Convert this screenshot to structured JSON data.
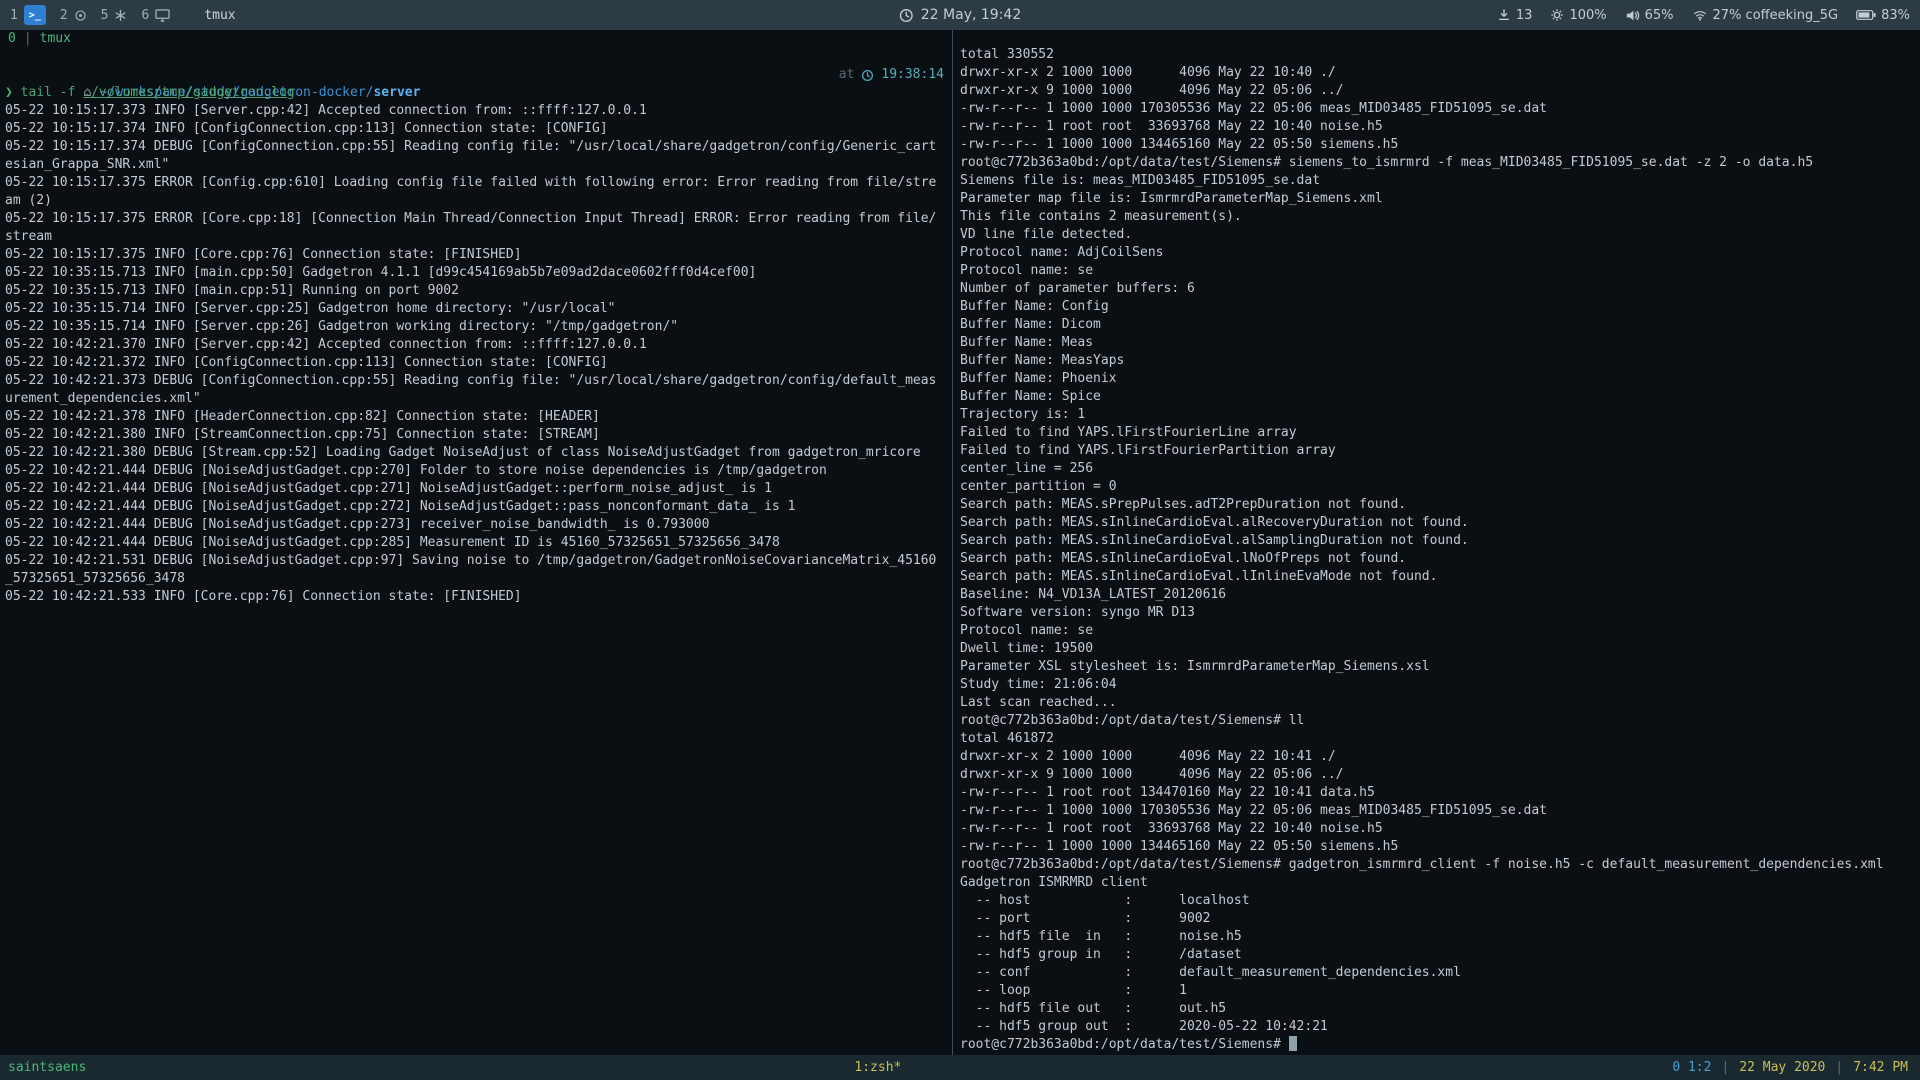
{
  "colors": {
    "terminal_bg": "#0a0f14",
    "topbar_bg": "#2d3c44",
    "statusbar_bg": "#1a2930",
    "text": "#c2cbd1",
    "green": "#4cb577",
    "yellow": "#c9bd55",
    "blue": "#4aa0d5",
    "cyan": "#58aebc",
    "accent_blue": "#2f7fd4",
    "cmd_green": "#4da273",
    "path_blue": "#3d8fd1",
    "dim": "#5a6a72"
  },
  "topbar": {
    "workspaces": [
      {
        "label": "1",
        "icon": "terminal-icon",
        "icon_glyph": ">_",
        "active": true
      },
      {
        "label": "2",
        "icon": "circle-icon",
        "active": false
      },
      {
        "label": "5",
        "icon": "asterisk-icon",
        "active": false
      },
      {
        "label": "6",
        "icon": "monitor-icon",
        "active": false
      }
    ],
    "window_title": "tmux",
    "clock": "22 May, 19:42",
    "status": {
      "downloads": "13",
      "brightness": "100%",
      "volume": "65%",
      "wifi": "27% coffeeking_5G",
      "battery": "83%"
    }
  },
  "left_pane": {
    "tmux_inner_status": {
      "window_index": "0",
      "separator": "|",
      "session_name": "tmux"
    },
    "prompt": {
      "symbol": "⌂",
      "path_prefix": "~/workspace/study/gadgetron-docker/",
      "path_current": "server",
      "at_label": "at",
      "time": "19:38:14"
    },
    "command": {
      "symbol": "❯ ",
      "text": "tail -f ",
      "arg": "./volumes/tmp/gadgetron.log"
    },
    "log_lines": [
      "05-22 10:15:17.373 INFO [Server.cpp:42] Accepted connection from: ::ffff:127.0.0.1",
      "05-22 10:15:17.374 INFO [ConfigConnection.cpp:113] Connection state: [CONFIG]",
      "05-22 10:15:17.374 DEBUG [ConfigConnection.cpp:55] Reading config file: \"/usr/local/share/gadgetron/config/Generic_cart",
      "esian_Grappa_SNR.xml\"",
      "05-22 10:15:17.375 ERROR [Config.cpp:610] Loading config file failed with following error: Error reading from file/stre",
      "am (2)",
      "05-22 10:15:17.375 ERROR [Core.cpp:18] [Connection Main Thread/Connection Input Thread] ERROR: Error reading from file/",
      "stream",
      "05-22 10:15:17.375 INFO [Core.cpp:76] Connection state: [FINISHED]",
      "05-22 10:35:15.713 INFO [main.cpp:50] Gadgetron 4.1.1 [d99c454169ab5b7e09ad2dace0602fff0d4cef00]",
      "05-22 10:35:15.713 INFO [main.cpp:51] Running on port 9002",
      "05-22 10:35:15.714 INFO [Server.cpp:25] Gadgetron home directory: \"/usr/local\"",
      "05-22 10:35:15.714 INFO [Server.cpp:26] Gadgetron working directory: \"/tmp/gadgetron/\"",
      "05-22 10:42:21.370 INFO [Server.cpp:42] Accepted connection from: ::ffff:127.0.0.1",
      "05-22 10:42:21.372 INFO [ConfigConnection.cpp:113] Connection state: [CONFIG]",
      "05-22 10:42:21.373 DEBUG [ConfigConnection.cpp:55] Reading config file: \"/usr/local/share/gadgetron/config/default_meas",
      "urement_dependencies.xml\"",
      "05-22 10:42:21.378 INFO [HeaderConnection.cpp:82] Connection state: [HEADER]",
      "05-22 10:42:21.380 INFO [StreamConnection.cpp:75] Connection state: [STREAM]",
      "05-22 10:42:21.380 DEBUG [Stream.cpp:52] Loading Gadget NoiseAdjust of class NoiseAdjustGadget from gadgetron_mricore",
      "05-22 10:42:21.444 DEBUG [NoiseAdjustGadget.cpp:270] Folder to store noise dependencies is /tmp/gadgetron",
      "05-22 10:42:21.444 DEBUG [NoiseAdjustGadget.cpp:271] NoiseAdjustGadget::perform_noise_adjust_ is 1",
      "05-22 10:42:21.444 DEBUG [NoiseAdjustGadget.cpp:272] NoiseAdjustGadget::pass_nonconformant_data_ is 1",
      "05-22 10:42:21.444 DEBUG [NoiseAdjustGadget.cpp:273] receiver_noise_bandwidth_ is 0.793000",
      "05-22 10:42:21.444 DEBUG [NoiseAdjustGadget.cpp:285] Measurement ID is 45160_57325651_57325656_3478",
      "05-22 10:42:21.531 DEBUG [NoiseAdjustGadget.cpp:97] Saving noise to /tmp/gadgetron/GadgetronNoiseCovarianceMatrix_45160",
      "_57325651_57325656_3478",
      "05-22 10:42:21.533 INFO [Core.cpp:76] Connection state: [FINISHED]"
    ]
  },
  "right_pane": {
    "lines": [
      "total 330552",
      "drwxr-xr-x 2 1000 1000      4096 May 22 10:40 ./",
      "drwxr-xr-x 9 1000 1000      4096 May 22 05:06 ../",
      "-rw-r--r-- 1 1000 1000 170305536 May 22 05:06 meas_MID03485_FID51095_se.dat",
      "-rw-r--r-- 1 root root  33693768 May 22 10:40 noise.h5",
      "-rw-r--r-- 1 1000 1000 134465160 May 22 05:50 siemens.h5",
      "root@c772b363a0bd:/opt/data/test/Siemens# siemens_to_ismrmrd -f meas_MID03485_FID51095_se.dat -z 2 -o data.h5",
      "Siemens file is: meas_MID03485_FID51095_se.dat",
      "Parameter map file is: IsmrmrdParameterMap_Siemens.xml",
      "This file contains 2 measurement(s).",
      "VD line file detected.",
      "Protocol name: AdjCoilSens",
      "Protocol name: se",
      "Number of parameter buffers: 6",
      "Buffer Name: Config",
      "Buffer Name: Dicom",
      "Buffer Name: Meas",
      "Buffer Name: MeasYaps",
      "Buffer Name: Phoenix",
      "Buffer Name: Spice",
      "Trajectory is: 1",
      "Failed to find YAPS.lFirstFourierLine array",
      "Failed to find YAPS.lFirstFourierPartition array",
      "center_line = 256",
      "center_partition = 0",
      "Search path: MEAS.sPrepPulses.adT2PrepDuration not found.",
      "Search path: MEAS.sInlineCardioEval.alRecoveryDuration not found.",
      "Search path: MEAS.sInlineCardioEval.alSamplingDuration not found.",
      "Search path: MEAS.sInlineCardioEval.lNoOfPreps not found.",
      "Search path: MEAS.sInlineCardioEval.lInlineEvaMode not found.",
      "Baseline: N4_VD13A_LATEST_20120616",
      "Software version: syngo MR D13",
      "Protocol name: se",
      "Dwell time: 19500",
      "Parameter XSL stylesheet is: IsmrmrdParameterMap_Siemens.xsl",
      "Study time: 21:06:04",
      "Last scan reached...",
      "root@c772b363a0bd:/opt/data/test/Siemens# ll",
      "total 461872",
      "drwxr-xr-x 2 1000 1000      4096 May 22 10:41 ./",
      "drwxr-xr-x 9 1000 1000      4096 May 22 05:06 ../",
      "-rw-r--r-- 1 root root 134470160 May 22 10:41 data.h5",
      "-rw-r--r-- 1 1000 1000 170305536 May 22 05:06 meas_MID03485_FID51095_se.dat",
      "-rw-r--r-- 1 root root  33693768 May 22 10:40 noise.h5",
      "-rw-r--r-- 1 1000 1000 134465160 May 22 05:50 siemens.h5",
      "root@c772b363a0bd:/opt/data/test/Siemens# gadgetron_ismrmrd_client -f noise.h5 -c default_measurement_dependencies.xml",
      "Gadgetron ISMRMRD client",
      "  -- host            :      localhost",
      "  -- port            :      9002",
      "  -- hdf5 file  in   :      noise.h5",
      "  -- hdf5 group in   :      /dataset",
      "  -- conf            :      default_measurement_dependencies.xml",
      "  -- loop            :      1",
      "  -- hdf5 file out   :      out.h5",
      "  -- hdf5 group out  :      2020-05-22 10:42:21"
    ],
    "last_prompt": "root@c772b363a0bd:/opt/data/test/Siemens# "
  },
  "statusbar": {
    "session": "saintsaens",
    "window": "1:zsh*",
    "pane_indicator": "0 1:2",
    "separator": "|",
    "date": "22 May 2020",
    "time": "7:42 PM"
  }
}
